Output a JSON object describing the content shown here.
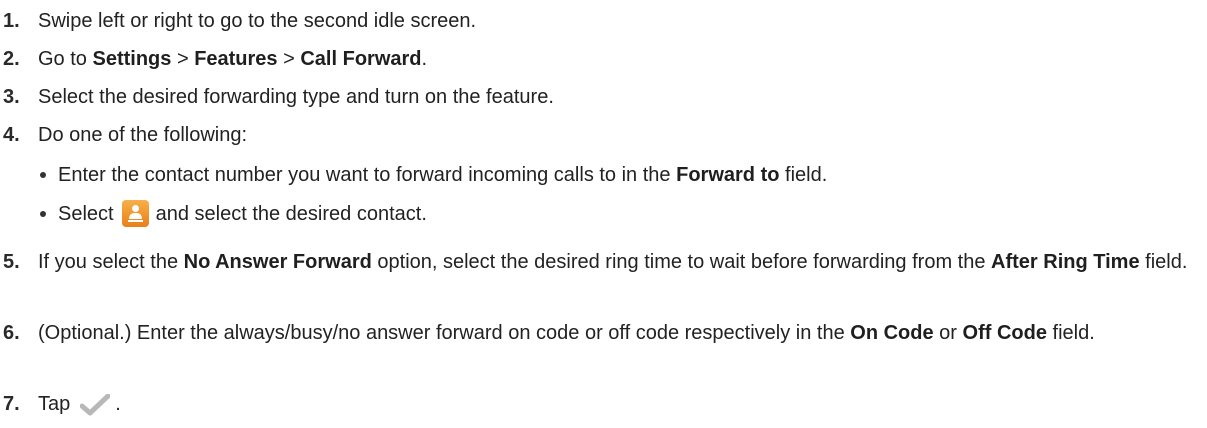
{
  "steps": [
    {
      "number": "1.",
      "segments": [
        "Swipe left or right to go to the second idle screen."
      ]
    },
    {
      "number": "2.",
      "segments": [
        "Go to ",
        "Settings",
        " > ",
        "Features",
        " > ",
        "Call Forward",
        "."
      ]
    },
    {
      "number": "3.",
      "segments": [
        "Select the desired forwarding type and turn on the feature."
      ]
    },
    {
      "number": "4.",
      "segments": [
        "Do one of the following:"
      ],
      "bullets": [
        {
          "segments": [
            "Enter the contact number you want to forward incoming calls to in the ",
            "Forward to",
            " field."
          ]
        },
        {
          "segments": [
            "Select",
            "and select the desired contact."
          ],
          "icon": "contacts-icon"
        }
      ]
    },
    {
      "number": "5.",
      "segments": [
        "If you select the ",
        "No Answer Forward",
        " option, select the desired ring time to wait before forwarding from the ",
        "After Ring Time",
        " field."
      ]
    },
    {
      "number": "6.",
      "segments": [
        "(Optional.) Enter the always/busy/no answer forward on code or off code respectively in the ",
        "On Code",
        " or ",
        "Off Code",
        " field."
      ]
    },
    {
      "number": "7.",
      "segments": [
        "Tap",
        "."
      ],
      "icon": "checkmark-icon"
    }
  ],
  "colors": {
    "text": "#222222",
    "contacts_icon": "#ea7f18",
    "checkmark_icon": "#b8b8b8"
  }
}
